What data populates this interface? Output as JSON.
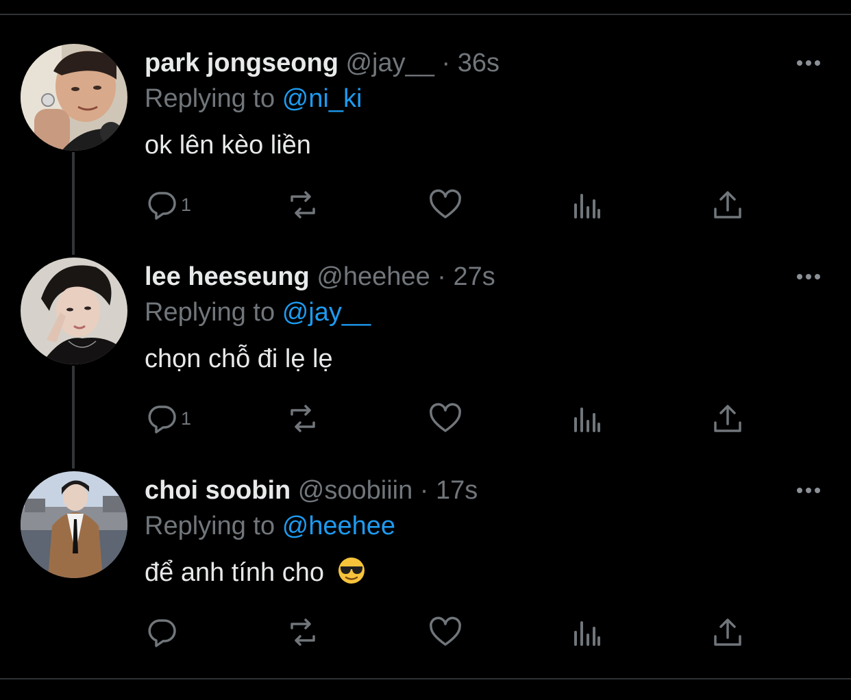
{
  "colors": {
    "background": "#000000",
    "primary_text": "#e7e9ea",
    "secondary_text": "#71767b",
    "accent": "#1d9bf0",
    "divider": "#2f3336"
  },
  "tweets": [
    {
      "display_name": "park jongseong",
      "handle": "@jay__",
      "separator": "·",
      "time": "36s",
      "replying_label": "Replying to",
      "replying_to": "@ni_ki",
      "text": "ok lên kèo liền",
      "reply_count": "1",
      "emoji": ""
    },
    {
      "display_name": "lee heeseung",
      "handle": "@heehee",
      "separator": "·",
      "time": "27s",
      "replying_label": "Replying to",
      "replying_to": "@jay__",
      "text": "chọn chỗ đi lẹ lẹ",
      "reply_count": "1",
      "emoji": ""
    },
    {
      "display_name": "choi soobin",
      "handle": "@soobiiin",
      "separator": "·",
      "time": "17s",
      "replying_label": "Replying to",
      "replying_to": "@heehee",
      "text": "để anh tính cho",
      "reply_count": "",
      "emoji": "smiling-face-with-sunglasses"
    }
  ],
  "icons": {
    "reply": "reply-icon",
    "retweet": "retweet-icon",
    "like": "heart-icon",
    "views": "views-icon",
    "share": "share-icon",
    "more": "more-icon"
  }
}
